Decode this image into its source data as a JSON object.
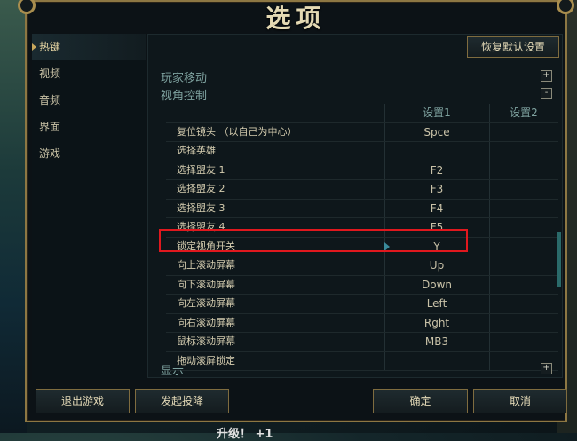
{
  "window": {
    "title": "选项"
  },
  "sidebar": {
    "items": [
      {
        "label": "热键",
        "active": true
      },
      {
        "label": "视频",
        "active": false
      },
      {
        "label": "音频",
        "active": false
      },
      {
        "label": "界面",
        "active": false
      },
      {
        "label": "游戏",
        "active": false
      }
    ]
  },
  "toolbar": {
    "restore_label": "恢复默认设置"
  },
  "sections": {
    "player_move": "玩家移动",
    "camera": "视角控制",
    "display": "显示"
  },
  "table": {
    "headers": {
      "col1": "设置1",
      "col2": "设置2"
    },
    "rows": [
      {
        "action": "复位镜头 （以自己为中心）",
        "s1": "Spce",
        "s2": ""
      },
      {
        "action": "选择英雄",
        "s1": "",
        "s2": ""
      },
      {
        "action": "选择盟友 1",
        "s1": "F2",
        "s2": ""
      },
      {
        "action": "选择盟友 2",
        "s1": "F3",
        "s2": ""
      },
      {
        "action": "选择盟友 3",
        "s1": "F4",
        "s2": ""
      },
      {
        "action": "选择盟友 4",
        "s1": "F5",
        "s2": ""
      },
      {
        "action": "锁定视角开关",
        "s1": "Y",
        "s2": ""
      },
      {
        "action": "向上滚动屏幕",
        "s1": "Up",
        "s2": ""
      },
      {
        "action": "向下滚动屏幕",
        "s1": "Down",
        "s2": ""
      },
      {
        "action": "向左滚动屏幕",
        "s1": "Left",
        "s2": ""
      },
      {
        "action": "向右滚动屏幕",
        "s1": "Rght",
        "s2": ""
      },
      {
        "action": "鼠标滚动屏幕",
        "s1": "MB3",
        "s2": ""
      },
      {
        "action": "拖动滚屏锁定",
        "s1": "",
        "s2": ""
      }
    ]
  },
  "buttons": {
    "exit": "退出游戏",
    "surrender": "发起投降",
    "ok": "确定",
    "cancel": "取消"
  },
  "footer": {
    "text": "升级！ +1"
  },
  "colors": {
    "gold": "#8d7743",
    "highlight": "#e0181e",
    "section": "#7fa3a0"
  },
  "icons": {
    "expand": "+",
    "collapse": "-"
  }
}
